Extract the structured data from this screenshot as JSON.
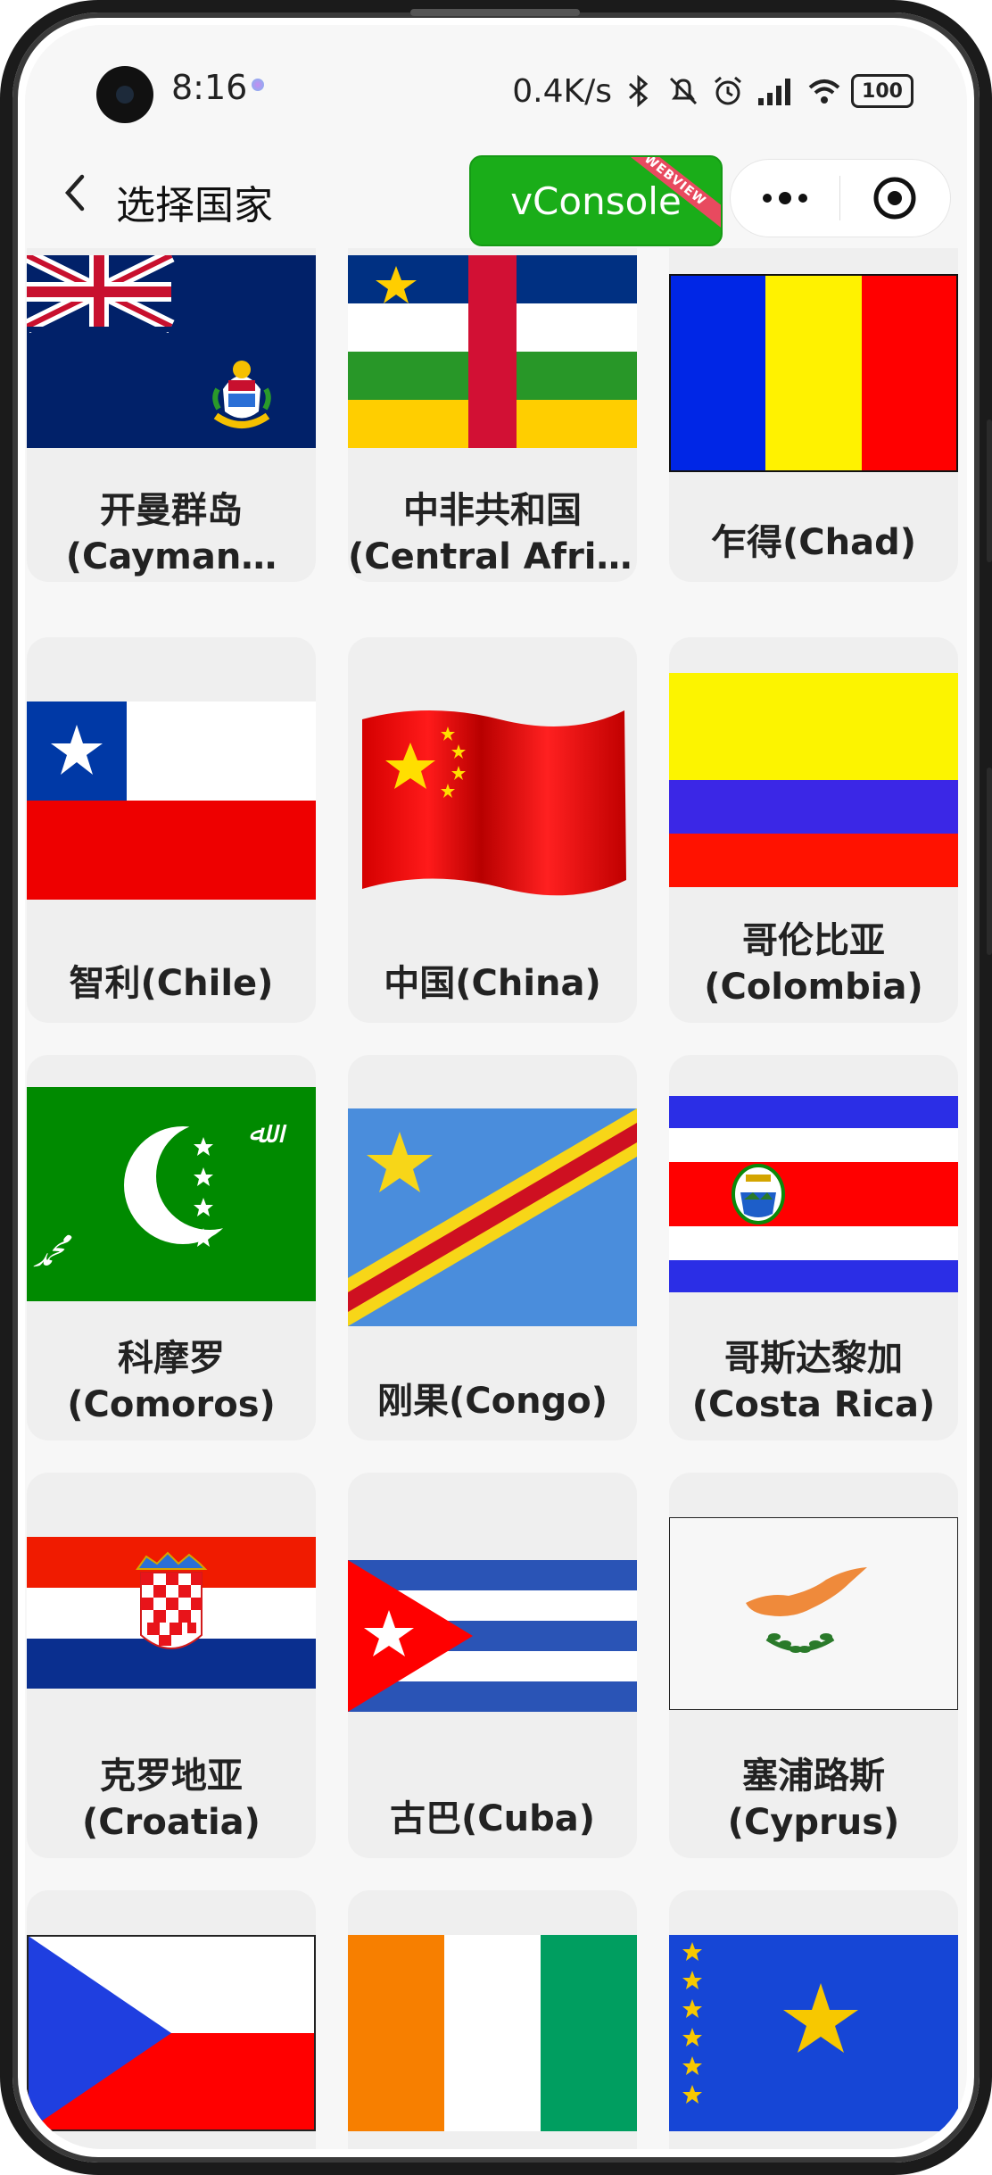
{
  "status_bar": {
    "time": "8:16",
    "net_speed": "0.4K/s",
    "battery": "100"
  },
  "nav": {
    "title": "选择国家",
    "vconsole_label": "vConsole",
    "webview_tag": "WEBVIEW"
  },
  "countries": [
    {
      "name": "开曼群岛",
      "en": "(Cayman…"
    },
    {
      "name": "中非共和国",
      "en": "(Central Afric…"
    },
    {
      "name": "乍得(Chad)",
      "en": ""
    },
    {
      "name": "智利(Chile)",
      "en": ""
    },
    {
      "name": "中国(China)",
      "en": ""
    },
    {
      "name": "哥伦比亚",
      "en": "(Colombia)"
    },
    {
      "name": "科摩罗",
      "en": "(Comoros)"
    },
    {
      "name": "刚果(Congo)",
      "en": ""
    },
    {
      "name": "哥斯达黎加",
      "en": "(Costa Rica)"
    },
    {
      "name": "克罗地亚",
      "en": "(Croatia)"
    },
    {
      "name": "古巴(Cuba)",
      "en": ""
    },
    {
      "name": "塞浦路斯",
      "en": "(Cyprus)"
    }
  ],
  "colors": {
    "vconsole_green": "#1aad19",
    "card_bg": "#efefef"
  }
}
